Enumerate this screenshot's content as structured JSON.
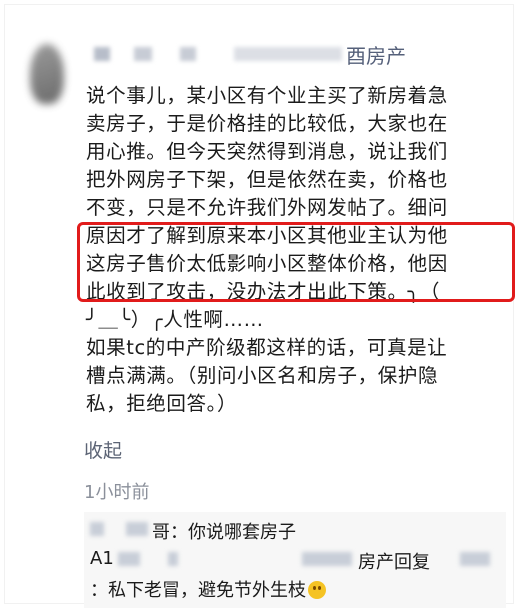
{
  "post": {
    "author_suffix": "酉房产",
    "lines": [
      "说个事儿，某小区有个业主买了新房着急",
      "卖房子，于是价格挂的比较低，大家也在",
      "用心推。但今天突然得到消息，说让我们",
      "把外网房子下架，但是依然在卖，价格也",
      "不变，只是不允许我们外网发帖了。细问",
      "原因才了解到原来本小区其他业主认为他",
      "这房子售价太低影响小区整体价格，他因",
      "此收到了攻击，没办法才出此下策。╮（",
      "╯＿╰）╭人性啊……",
      "如果tc的中产阶级都这样的话，可真是让",
      "槽点满满。（别问小区名和房子，保护隐",
      "私，拒绝回答。）"
    ],
    "collapse_label": "收起",
    "timestamp": "1小时前"
  },
  "comments": {
    "c1_text": "哥：你说哪套房子",
    "c2_prefix": "A1",
    "c2_text": "房产回复",
    "c3_text": "：私下老冒，避免节外生枝"
  },
  "colors": {
    "highlight": "#e11b1b",
    "link": "#55607a",
    "meta": "#8b909b"
  }
}
